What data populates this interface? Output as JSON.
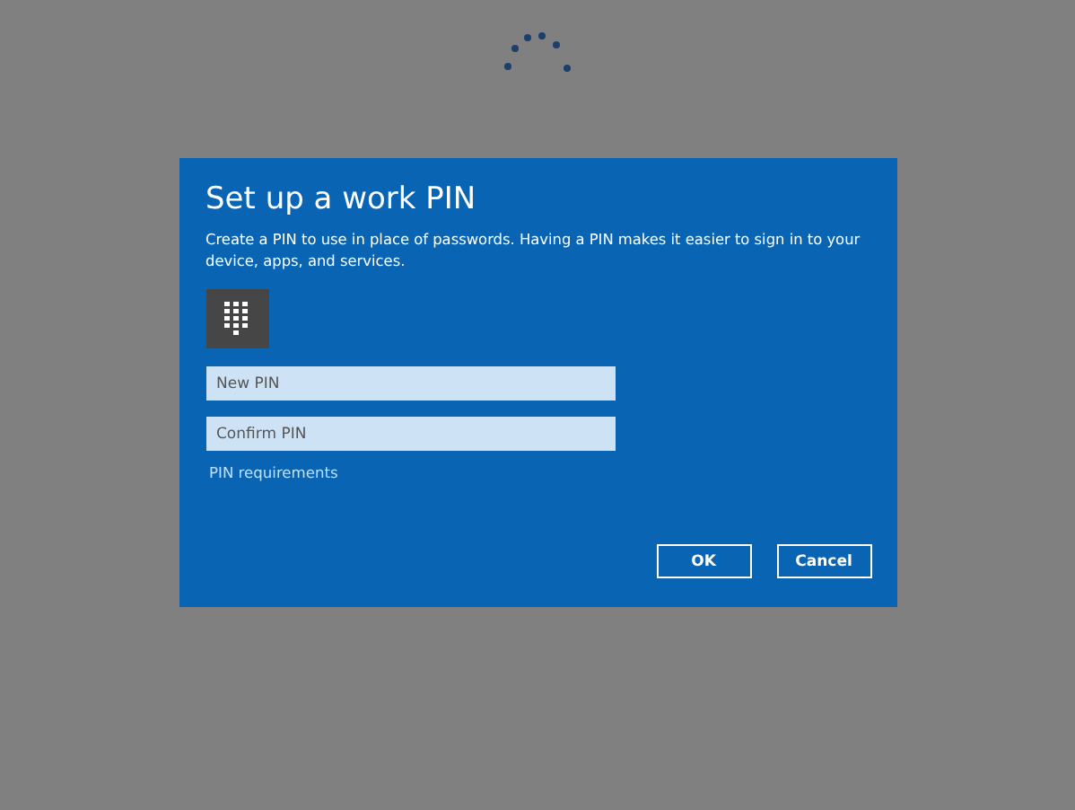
{
  "dialog": {
    "title": "Set up a work PIN",
    "description": "Create a PIN to use in place of passwords. Having a PIN makes it easier to sign in to your device, apps, and services.",
    "fields": [
      {
        "placeholder": "New PIN"
      },
      {
        "placeholder": "Confirm PIN"
      }
    ],
    "link": "PIN requirements",
    "buttons": [
      "OK",
      "Cancel"
    ]
  }
}
